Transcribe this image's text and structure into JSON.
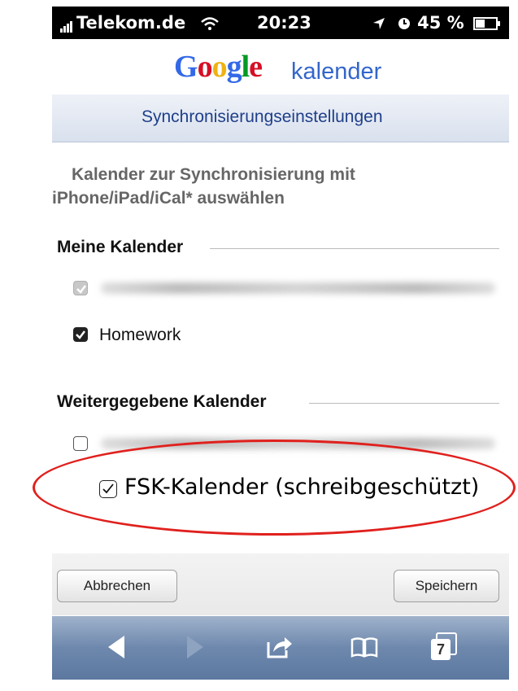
{
  "statusbar": {
    "carrier": "Telekom.de",
    "time": "20:23",
    "battery": "45 %",
    "battery_level_percent": 45
  },
  "header": {
    "logo": "Google",
    "product": "kalender"
  },
  "titlebar": {
    "title": "Synchronisierungseinstellungen"
  },
  "intro": {
    "line1": "Kalender zur Synchronisierung mit",
    "line2": "iPhone/iPad/iCal* auswählen"
  },
  "my_calendars": {
    "heading": "Meine Kalender",
    "items": [
      {
        "label": "",
        "checked": true,
        "disabled": true
      },
      {
        "label": "Homework",
        "checked": true
      }
    ]
  },
  "shared_calendars": {
    "heading": "Weitergegebene Kalender",
    "items": [
      {
        "label": "",
        "checked": false
      },
      {
        "label": "FSK-Kalender (schreibgeschützt)",
        "checked": true
      }
    ]
  },
  "buttons": {
    "cancel": "Abbrechen",
    "save": "Speichern"
  },
  "toolbar": {
    "tabs_count": "7",
    "icons": [
      "back-icon",
      "forward-icon",
      "share-icon",
      "bookmarks-icon",
      "tabs-icon"
    ]
  },
  "colors": {
    "accent": "#3366cc",
    "highlight": "#e0201d",
    "toolbar": "#6e88ad"
  }
}
